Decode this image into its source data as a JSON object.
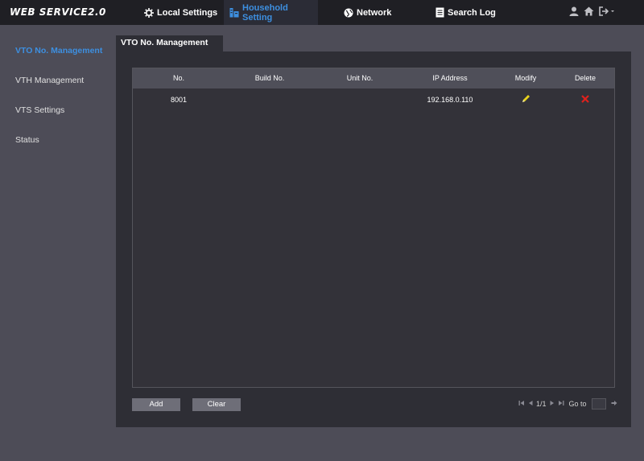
{
  "app": {
    "brand": "WEB SERVICE2.0"
  },
  "nav": {
    "items": [
      {
        "label": "Local Settings",
        "icon": "gear-icon"
      },
      {
        "label": "Household Setting",
        "icon": "building-icon",
        "active": true
      },
      {
        "label": "Network",
        "icon": "globe-icon"
      },
      {
        "label": "Search Log",
        "icon": "document-icon"
      }
    ],
    "right_icons": [
      "user-icon",
      "home-icon",
      "logout-icon"
    ]
  },
  "sidebar": {
    "items": [
      {
        "label": "VTO No. Management",
        "active": true
      },
      {
        "label": "VTH Management"
      },
      {
        "label": "VTS Settings"
      },
      {
        "label": "Status"
      }
    ]
  },
  "tab": {
    "label": "VTO No. Management"
  },
  "table": {
    "columns": [
      "No.",
      "Build No.",
      "Unit No.",
      "IP Address",
      "Modify",
      "Delete"
    ],
    "rows": [
      {
        "no": "8001",
        "build": "",
        "unit": "",
        "ip": "192.168.0.110",
        "modify_icon": "pencil-icon",
        "delete_icon": "close-icon"
      }
    ]
  },
  "actions": {
    "add_label": "Add",
    "clear_label": "Clear"
  },
  "pagination": {
    "page_text": "1/1",
    "goto_label": "Go to",
    "goto_value": ""
  },
  "colors": {
    "accent": "#3d8fe0",
    "pencil": "#e8d21c",
    "delete": "#e0201c"
  }
}
